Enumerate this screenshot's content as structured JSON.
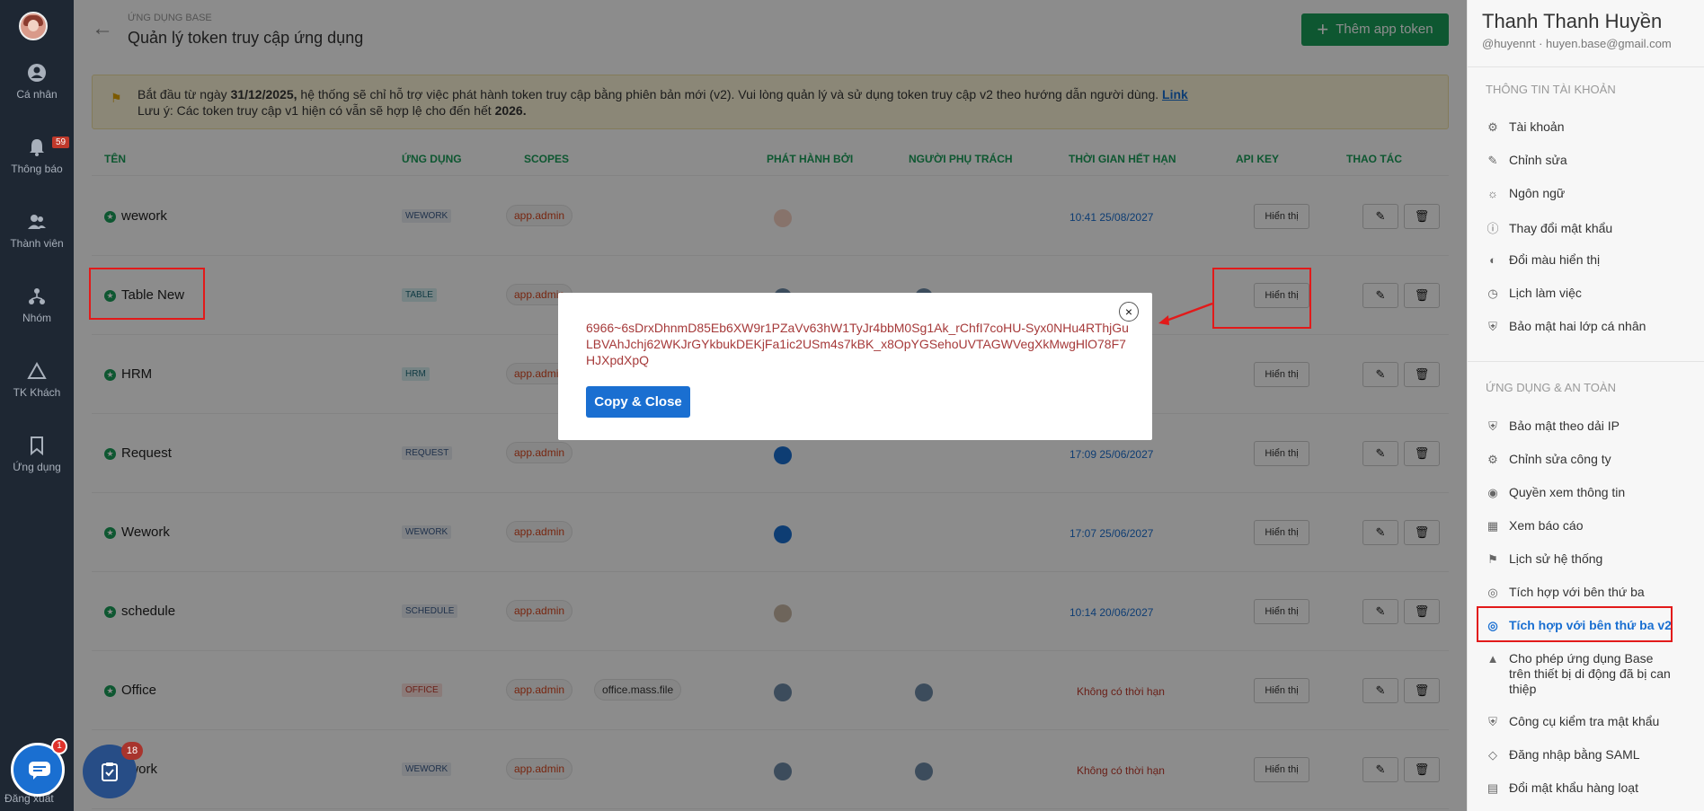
{
  "nav": {
    "items": [
      {
        "label": "Cá nhân",
        "icon": "person-icon"
      },
      {
        "label": "Thông báo",
        "icon": "bell-icon",
        "badge": "59"
      },
      {
        "label": "Thành viên",
        "icon": "members-icon"
      },
      {
        "label": "Nhóm",
        "icon": "group-icon"
      },
      {
        "label": "TK Khách",
        "icon": "guest-icon"
      },
      {
        "label": "Ứng dụng",
        "icon": "bookmark-icon"
      }
    ],
    "logout": "Đăng xuất"
  },
  "header": {
    "breadcrumb": "ỨNG DỤNG BASE",
    "title": "Quản lý token truy cập ứng dụng",
    "add_button": "Thêm app token"
  },
  "notice": {
    "line1_a": "Bắt đầu từ ngày ",
    "line1_date": "31/12/2025,",
    "line1_b": " hệ thống sẽ chỉ hỗ trợ việc phát hành token truy cập bằng phiên bản mới (v2). Vui lòng quản lý và sử dụng token truy cập v2 theo hướng dẫn người dùng. ",
    "link": "Link",
    "line2_a": "Lưu ý: Các token truy cập v1 hiện có vẫn sẽ hợp lệ cho đến hết ",
    "line2_year": "2026."
  },
  "table": {
    "columns": [
      "TÊN",
      "ỨNG DỤNG",
      "SCOPES",
      "PHÁT HÀNH BỞI",
      "NGƯỜI PHỤ TRÁCH",
      "THỜI GIAN HẾT HẠN",
      "API KEY",
      "THAO TÁC"
    ],
    "show_label": "Hiển thị",
    "rows": [
      {
        "name": "wework",
        "app": "WEWORK",
        "scopes": [
          "app.admin"
        ],
        "expiry": "10:41 25/08/2027"
      },
      {
        "name": "Table New",
        "app": "TABLE",
        "scopes": [
          "app.admin"
        ],
        "expiry": ""
      },
      {
        "name": "HRM",
        "app": "HRM",
        "scopes": [
          "app.admin"
        ],
        "expiry": ""
      },
      {
        "name": "Request",
        "app": "REQUEST",
        "scopes": [
          "app.admin"
        ],
        "expiry": "17:09 25/06/2027"
      },
      {
        "name": "Wework",
        "app": "WEWORK",
        "scopes": [
          "app.admin"
        ],
        "expiry": "17:07 25/06/2027"
      },
      {
        "name": "schedule",
        "app": "SCHEDULE",
        "scopes": [
          "app.admin"
        ],
        "expiry": "10:14 20/06/2027"
      },
      {
        "name": "Office",
        "app": "OFFICE",
        "scopes": [
          "app.admin",
          "office.mass.file"
        ],
        "expiry": "Không có thời hạn"
      },
      {
        "name": "ework",
        "app": "WEWORK",
        "scopes": [
          "app.admin"
        ],
        "expiry": "Không có thời hạn"
      }
    ]
  },
  "modal": {
    "token": "6966~6sDrxDhnmD85Eb6XW9r1PZaVv63hW1TyJr4bbM0Sg1Ak_rChfI7coHU-Syx0NHu4RThjGuLBVAhJchj62WKJrGYkbukDEKjFa1ic2USm4s7kBK_x8OpYGSehoUVTAGWVegXkMwgHlO78F7HJXpdXpQ",
    "close": "×",
    "copy_button": "Copy & Close"
  },
  "profile": {
    "name": "Thanh Thanh Huyền",
    "handle": "@huyennt  ·  huyen.base@gmail.com"
  },
  "right_sections": {
    "account_title": "THÔNG TIN TÀI KHOẢN",
    "account_items": [
      {
        "label": "Tài khoản",
        "icon": "gear-icon"
      },
      {
        "label": "Chỉnh sửa",
        "icon": "pencil-icon"
      },
      {
        "label": "Ngôn ngữ",
        "icon": "compass-icon"
      },
      {
        "label": "Thay đổi mật khẩu",
        "icon": "alert-icon"
      },
      {
        "label": "Đổi màu hiển thị",
        "icon": "palette-icon"
      },
      {
        "label": "Lịch làm việc",
        "icon": "clock-icon"
      },
      {
        "label": "Bảo mật hai lớp cá nhân",
        "icon": "shield-icon"
      }
    ],
    "apps_title": "ỨNG DỤNG & AN TOÀN",
    "apps_items": [
      {
        "label": "Bảo mật theo dải IP",
        "icon": "shield-icon"
      },
      {
        "label": "Chỉnh sửa công ty",
        "icon": "gear-icon"
      },
      {
        "label": "Quyền xem thông tin",
        "icon": "eye-icon"
      },
      {
        "label": "Xem báo cáo",
        "icon": "grid-icon"
      },
      {
        "label": "Lịch sử hệ thống",
        "icon": "flag-icon"
      },
      {
        "label": "Tích hợp với bên thứ ba",
        "icon": "globe-icon"
      },
      {
        "label": "Tích hợp với bên thứ ba v2",
        "icon": "globe-icon"
      },
      {
        "label": "Cho phép ứng dụng Base trên thiết bị di động đã bị can thiệp",
        "icon": "android-icon"
      },
      {
        "label": "Công cụ kiểm tra mật khẩu",
        "icon": "shield-icon"
      },
      {
        "label": "Đăng nhập bằng SAML",
        "icon": "lock-icon"
      },
      {
        "label": "Đổi mật khẩu hàng loạt",
        "icon": "table-icon"
      }
    ]
  },
  "floating": {
    "chat_badge": "1",
    "task_badge": "18"
  },
  "colors": {
    "accent_green": "#1a9e5a",
    "accent_blue": "#1a6fd1",
    "annotation_red": "#e21a1a"
  }
}
